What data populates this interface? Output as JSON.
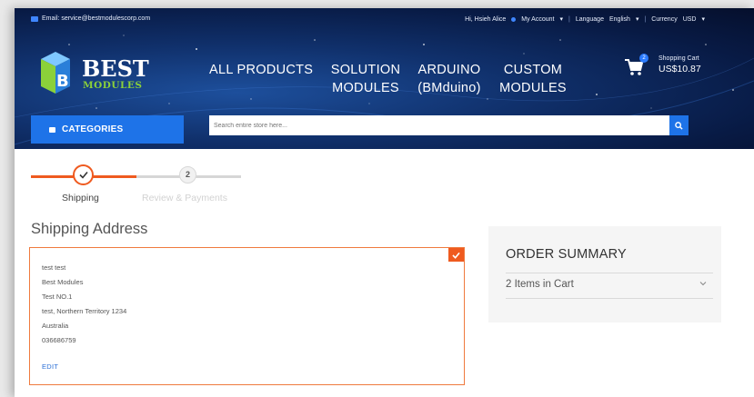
{
  "topbar": {
    "email": "Email: service@bestmodulescorp.com",
    "greeting": "Hi, Hsieh Alice",
    "my_account": "My Account",
    "language_label": "Language",
    "language_value": "English",
    "currency_label": "Currency",
    "currency_value": "USD"
  },
  "logo": {
    "line1": "BEST",
    "line2": "MODULES"
  },
  "nav": {
    "all_products": "ALL PRODUCTS",
    "solution_line1": "SOLUTION",
    "solution_line2": "MODULES",
    "arduino_line1": "ARDUINO",
    "arduino_line2": "(BMduino)",
    "custom_line1": "CUSTOM",
    "custom_line2": "MODULES"
  },
  "cart": {
    "count": "2",
    "title": "Shopping Cart",
    "total": "US$10.87"
  },
  "categories_label": "CATEGORIES",
  "search": {
    "placeholder": "Search entire store here..."
  },
  "progress": {
    "step1_label": "Shipping",
    "step2_number": "2",
    "step2_label": "Review & Payments"
  },
  "shipping": {
    "title": "Shipping Address",
    "address_lines": [
      "test test",
      "Best Modules",
      "Test NO.1",
      "test, Northern Territory 1234",
      "Australia",
      "036686759"
    ],
    "edit_label": "EDIT"
  },
  "summary": {
    "title": "ORDER SUMMARY",
    "items_label": "2 Items in Cart"
  },
  "colors": {
    "accent_orange": "#ef5a1f",
    "brand_blue": "#1e73e8",
    "logo_green": "#8bd13a"
  }
}
